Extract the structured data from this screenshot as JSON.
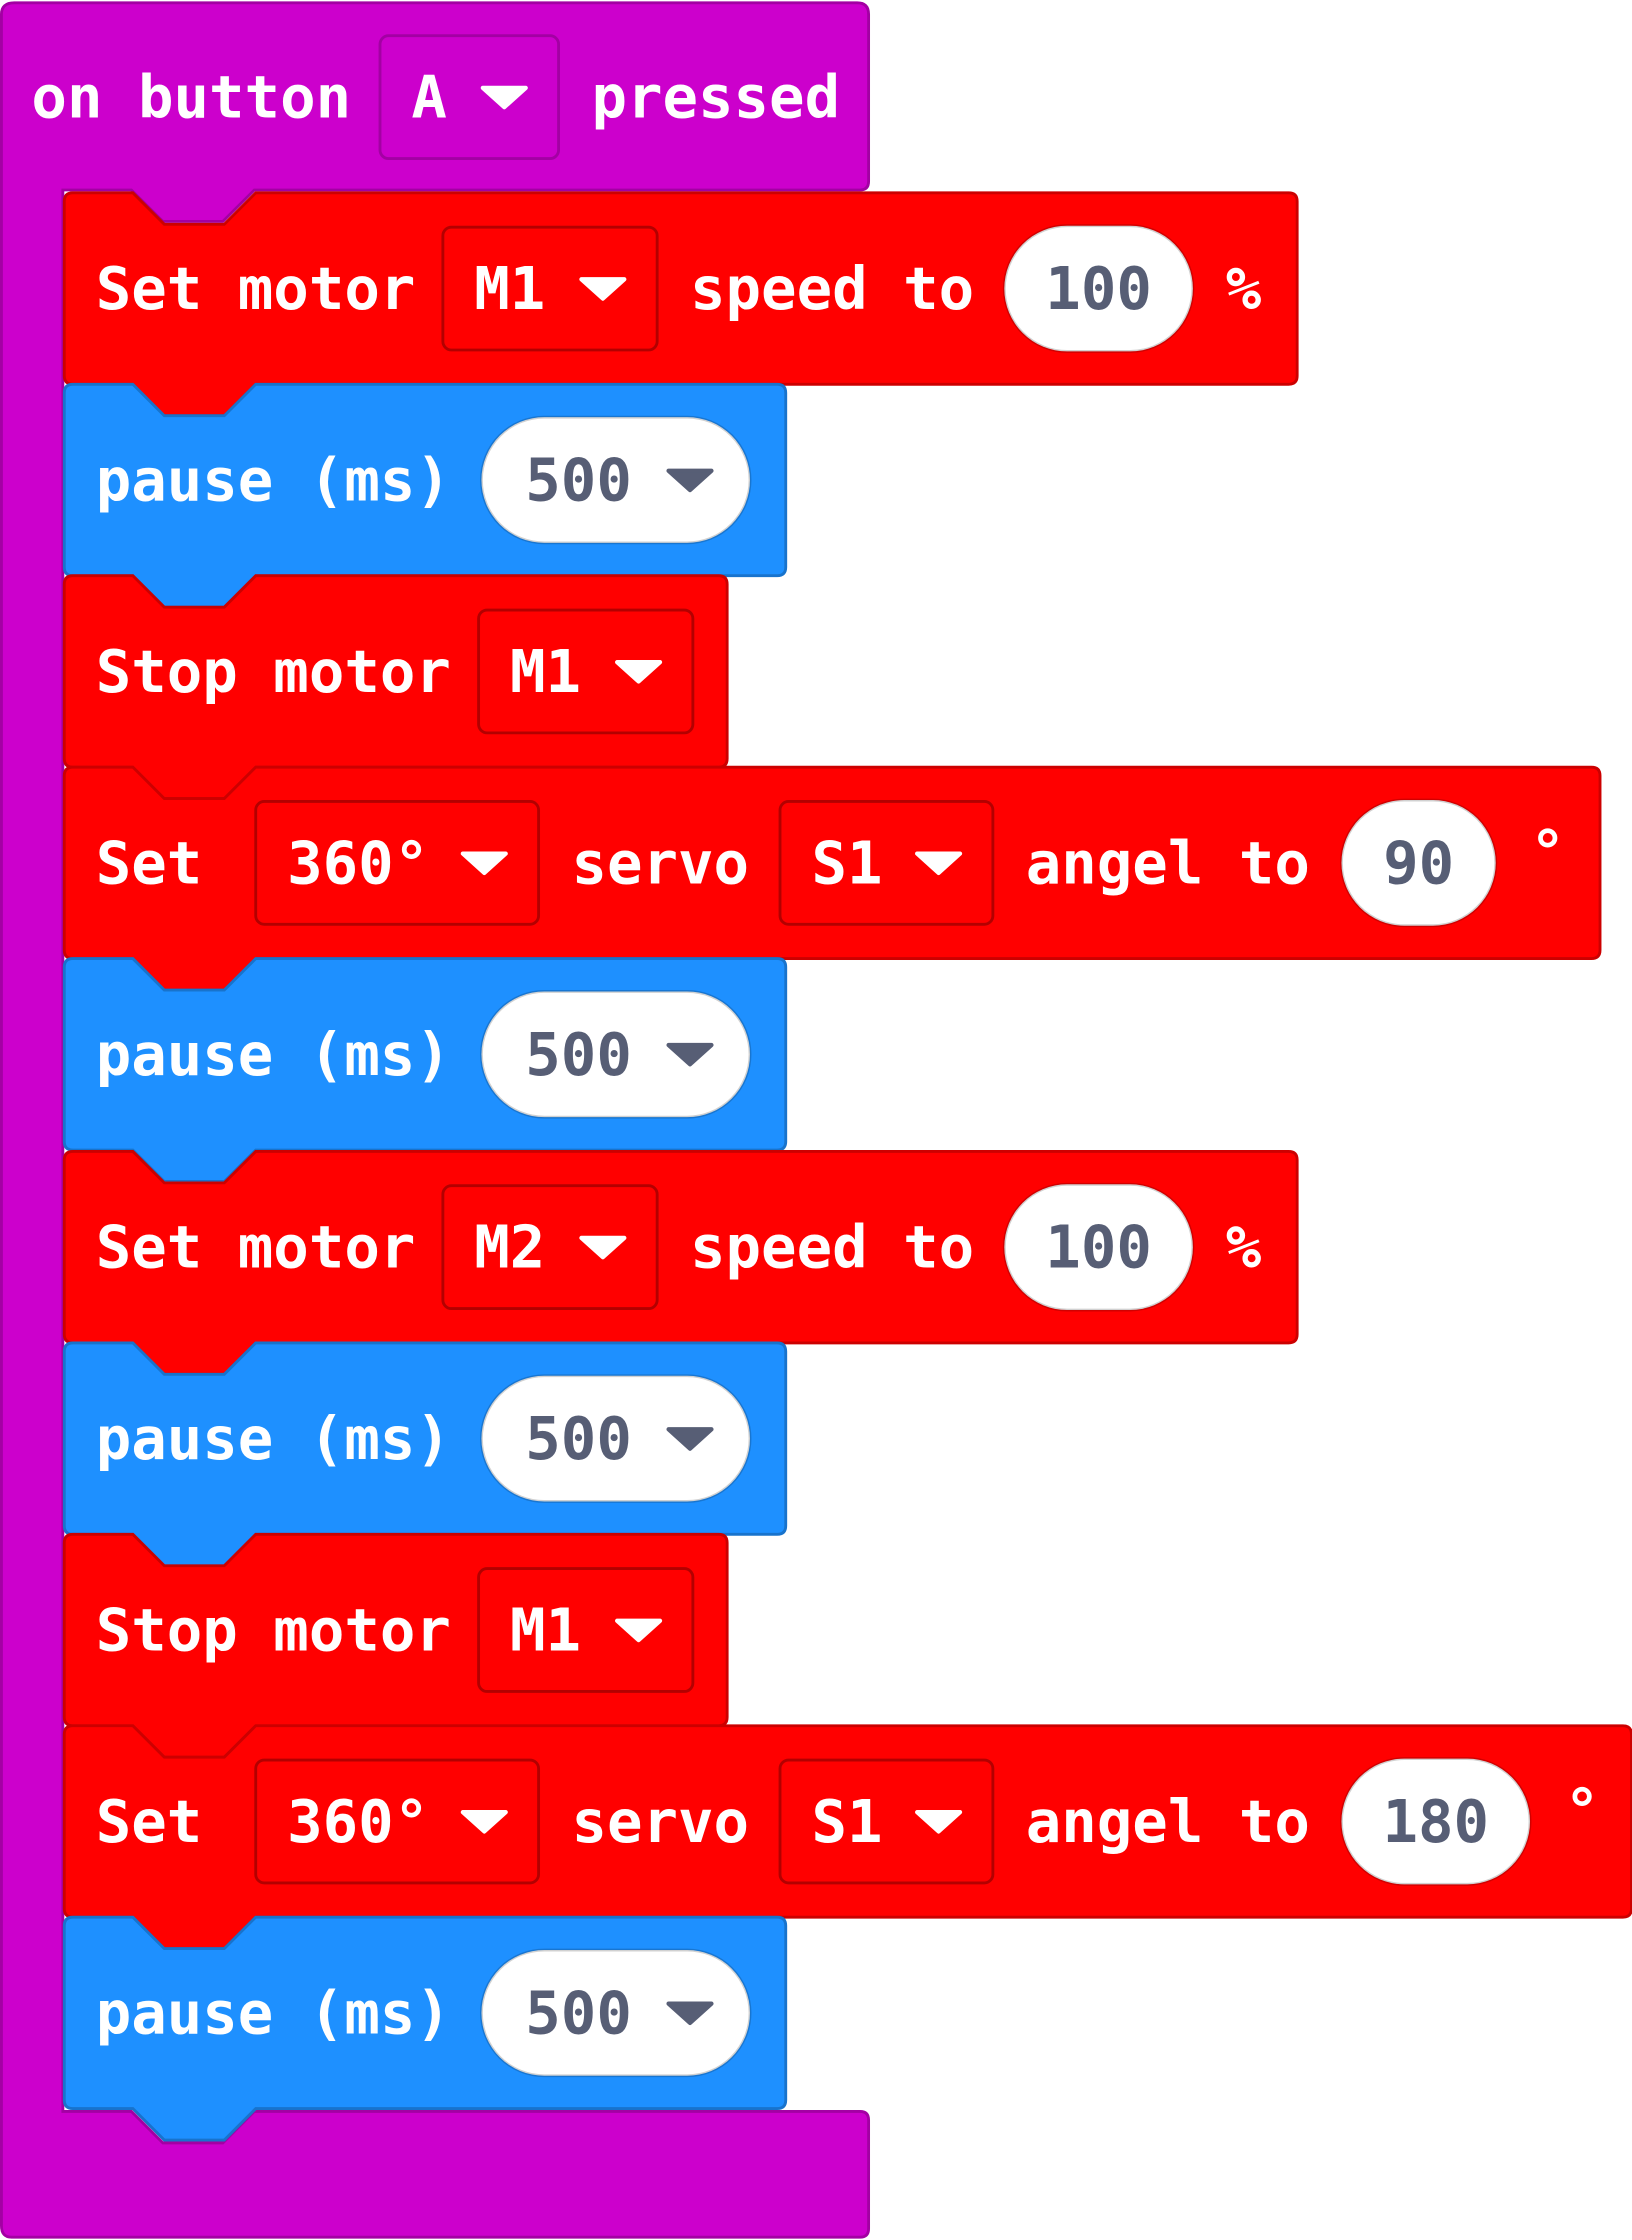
{
  "colors": {
    "event": "#cc00cc",
    "event_border": "#a300a3",
    "motor": "#ff0000",
    "motor_border": "#cc0000",
    "pause": "#1e90ff",
    "pause_border": "#1873cc",
    "value_text": "#575e75",
    "label_text": "#ffffff"
  },
  "event_block": {
    "label_before": "on button",
    "button_field": "A",
    "button_field_icon": "caret-down-icon",
    "label_after": "pressed"
  },
  "statements": [
    {
      "kind": "set-motor",
      "label": "Set motor",
      "motor": "M1",
      "label2": "speed to",
      "value": "100",
      "unit": "%"
    },
    {
      "kind": "pause",
      "label": "pause (ms)",
      "value": "500"
    },
    {
      "kind": "stop-motor",
      "label": "Stop motor",
      "motor": "M1"
    },
    {
      "kind": "set-servo",
      "label": "Set",
      "servo_type": "360°",
      "label2": "servo",
      "servo": "S1",
      "label3": "angel to",
      "value": "90",
      "unit": "°"
    },
    {
      "kind": "pause",
      "label": "pause (ms)",
      "value": "500"
    },
    {
      "kind": "set-motor",
      "label": "Set motor",
      "motor": "M2",
      "label2": "speed to",
      "value": "100",
      "unit": "%"
    },
    {
      "kind": "pause",
      "label": "pause (ms)",
      "value": "500"
    },
    {
      "kind": "stop-motor",
      "label": "Stop motor",
      "motor": "M1"
    },
    {
      "kind": "set-servo",
      "label": "Set",
      "servo_type": "360°",
      "label2": "servo",
      "servo": "S1",
      "label3": "angel to",
      "value": "180",
      "unit": "°"
    },
    {
      "kind": "pause",
      "label": "pause (ms)",
      "value": "500"
    }
  ]
}
